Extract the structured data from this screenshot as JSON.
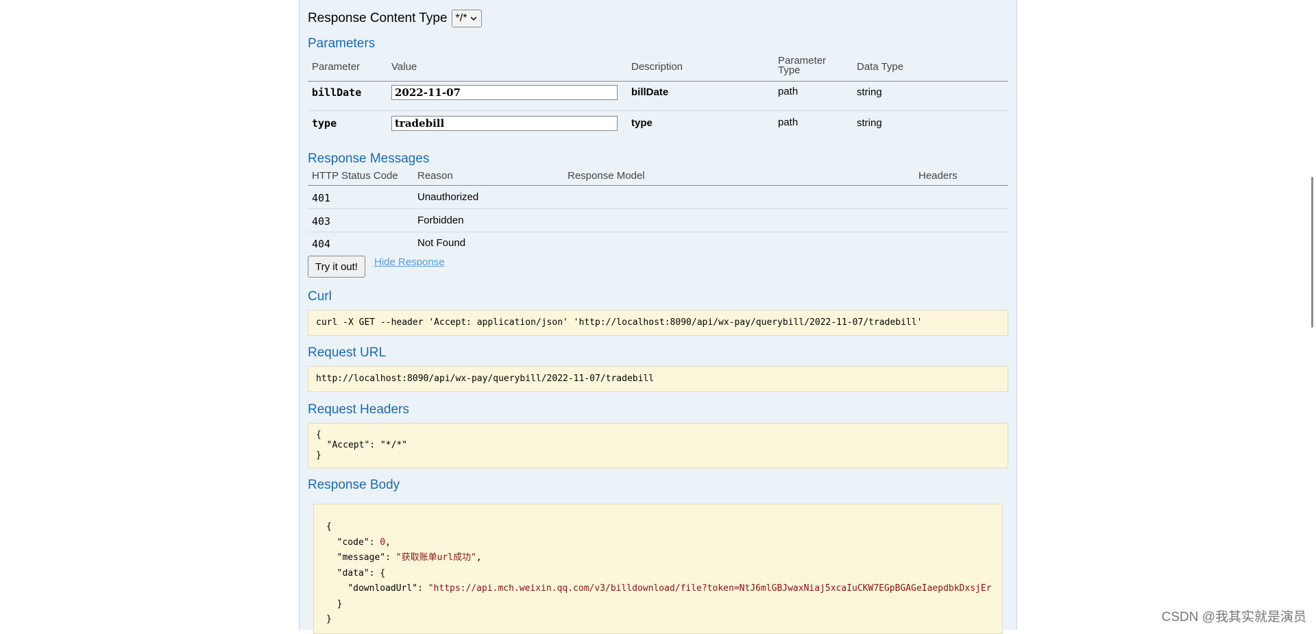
{
  "response_content_type": {
    "label": "Response Content Type",
    "selected": "*/*"
  },
  "parameters": {
    "heading": "Parameters",
    "columns": [
      "Parameter",
      "Value",
      "Description",
      "Parameter Type",
      "Data Type"
    ],
    "rows": [
      {
        "name": "billDate",
        "value": "2022-11-07",
        "description": "billDate",
        "param_type": "path",
        "data_type": "string"
      },
      {
        "name": "type",
        "value": "tradebill",
        "description": "type",
        "param_type": "path",
        "data_type": "string"
      }
    ]
  },
  "response_messages": {
    "heading": "Response Messages",
    "columns": [
      "HTTP Status Code",
      "Reason",
      "Response Model",
      "Headers"
    ],
    "rows": [
      {
        "code": "401",
        "reason": "Unauthorized"
      },
      {
        "code": "403",
        "reason": "Forbidden"
      },
      {
        "code": "404",
        "reason": "Not Found"
      }
    ]
  },
  "actions": {
    "try_label": "Try it out!",
    "hide_label": "Hide Response"
  },
  "curl": {
    "heading": "Curl",
    "text": "curl -X GET --header 'Accept: application/json' 'http://localhost:8090/api/wx-pay/querybill/2022-11-07/tradebill'"
  },
  "request_url": {
    "heading": "Request URL",
    "text": "http://localhost:8090/api/wx-pay/querybill/2022-11-07/tradebill"
  },
  "request_headers": {
    "heading": "Request Headers",
    "lines": [
      "{",
      "  \"Accept\": \"*/*\"",
      "}"
    ]
  },
  "response_body": {
    "heading": "Response Body",
    "open": "{",
    "code_key": "\"code\"",
    "code_val": "0",
    "message_key": "\"message\"",
    "message_val": "\"获取账单url成功\"",
    "data_key": "\"data\"",
    "download_key": "\"downloadUrl\"",
    "download_val": "\"https://api.mch.weixin.qq.com/v3/billdownload/file?token=NtJ6mlGBJwaxNiaj5xcaIuCKW7EGpBGAGeIaepdbkDxsjEr",
    "close_inner": "}",
    "close": "}"
  },
  "watermark": "CSDN @我其实就是演员"
}
